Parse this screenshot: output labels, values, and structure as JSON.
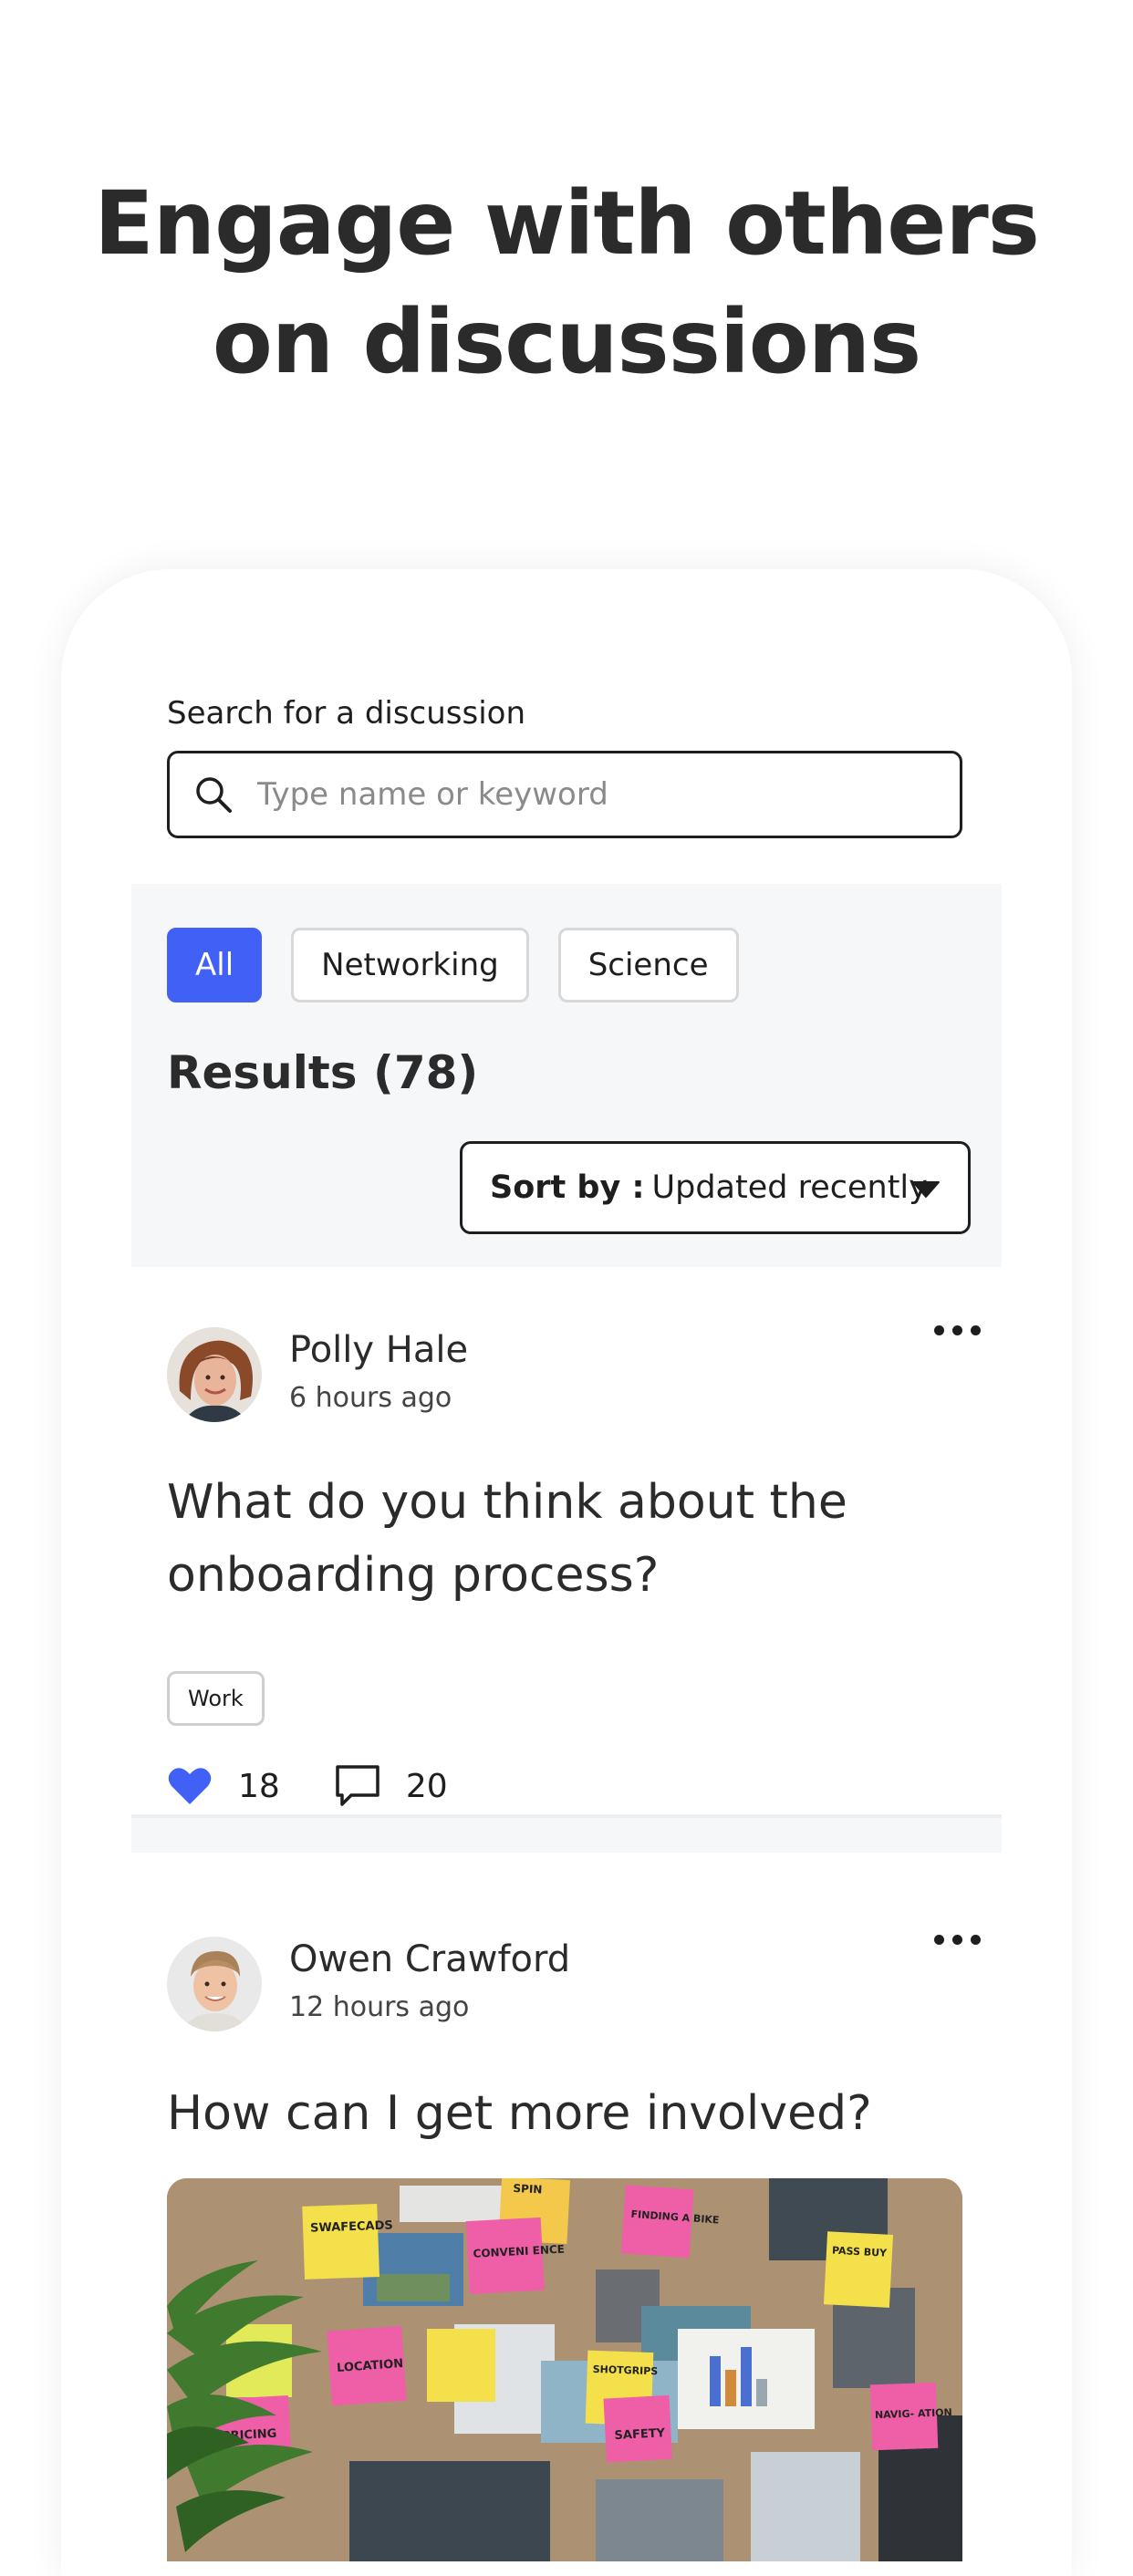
{
  "headline": {
    "line1": "Engage with others",
    "line2": "on discussions"
  },
  "search": {
    "label": "Search for a discussion",
    "placeholder": "Type name or keyword"
  },
  "filters": {
    "chips": [
      "All",
      "Networking",
      "Science"
    ],
    "active": "All"
  },
  "results": {
    "title": "Results (78)"
  },
  "sort": {
    "label": "Sort by :",
    "value": "Updated recently"
  },
  "posts": [
    {
      "author": "Polly Hale",
      "time": "6 hours ago",
      "title": "What do you think about the onboarding process?",
      "tag": "Work",
      "likes": "18",
      "comments": "20"
    },
    {
      "author": "Owen Crawford",
      "time": "12 hours ago",
      "title": "How can I get more involved?"
    }
  ],
  "image_notes": {
    "n1": "SWAFECADS",
    "n2": "FINDING A BIKE",
    "n3": "CONVENI ENCE",
    "n4": "LOCATION",
    "n5": "SHOTGRIPS",
    "n6": "NAVIG- ATION",
    "n7": "SAFETY",
    "n8": "PRICING",
    "n9": "PASS BUY",
    "n10": "SPIN"
  },
  "colors": {
    "accent": "#4160f5",
    "text": "#2b2b2b",
    "panel": "#f6f7f9"
  }
}
